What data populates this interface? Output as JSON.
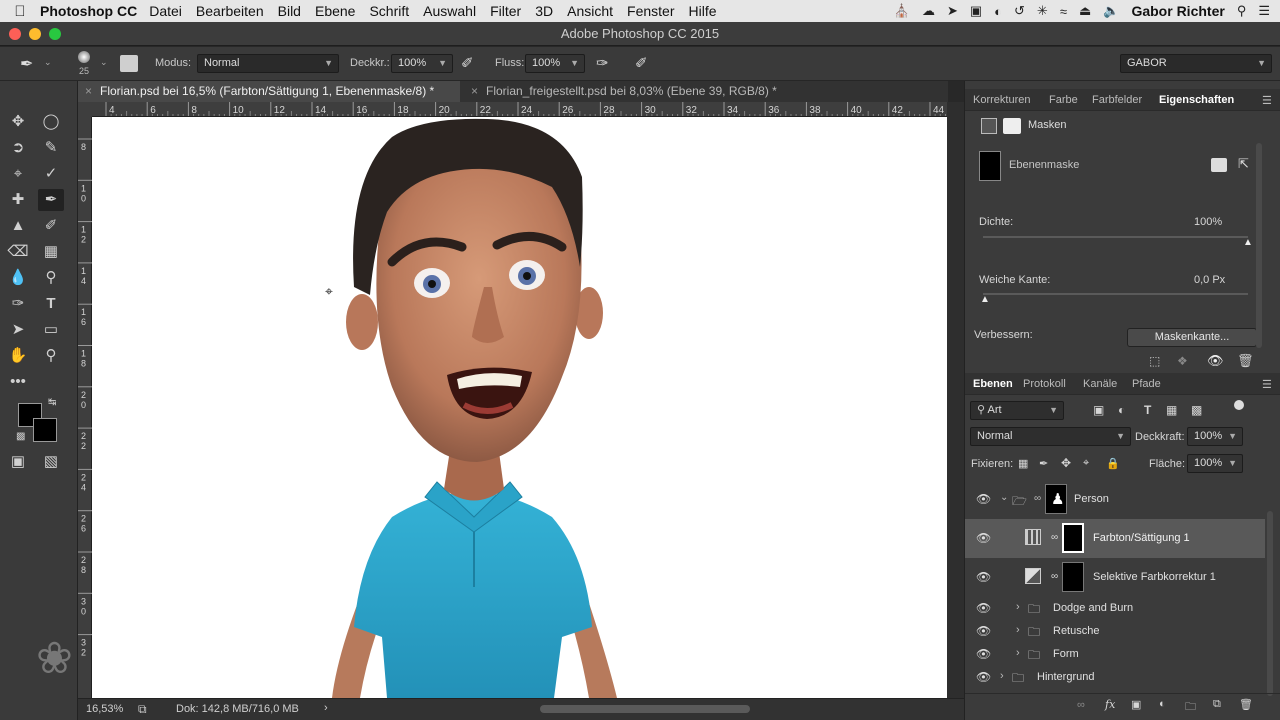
{
  "menubar": {
    "app_name": "Photoshop CC",
    "items": [
      "Datei",
      "Bearbeiten",
      "Bild",
      "Ebene",
      "Schrift",
      "Auswahl",
      "Filter",
      "3D",
      "Ansicht",
      "Fenster",
      "Hilfe"
    ],
    "user": "Gabor Richter"
  },
  "window": {
    "title": "Adobe Photoshop CC 2015"
  },
  "options": {
    "brush_size": "25",
    "mode_label": "Modus:",
    "mode_value": "Normal",
    "opacity_label": "Deckkr.:",
    "opacity_value": "100%",
    "flow_label": "Fluss:",
    "flow_value": "100%",
    "workspace": "GABOR"
  },
  "tabs": [
    {
      "label": "Florian.psd bei 16,5% (Farbton/Sättigung 1, Ebenenmaske/8) *",
      "active": true
    },
    {
      "label": "Florian_freigestellt.psd bei 8,03% (Ebene 39, RGB/8) *",
      "active": false
    }
  ],
  "ruler": {
    "h_ticks": [
      "4",
      "6",
      "8",
      "10",
      "12",
      "14",
      "16",
      "18",
      "20",
      "22",
      "24",
      "26",
      "28",
      "30",
      "32",
      "34",
      "36",
      "38",
      "40",
      "42",
      "44",
      "46"
    ],
    "v_ticks": [
      "8",
      "1\n0",
      "1\n2",
      "1\n4",
      "1\n6",
      "1\n8",
      "2\n0",
      "2\n2",
      "2\n4",
      "2\n6",
      "2\n8",
      "3\n0",
      "3\n2"
    ]
  },
  "status": {
    "zoom": "16,53%",
    "doc": "Dok: 142,8 MB/716,0 MB"
  },
  "properties_panel": {
    "tabs": [
      "Korrekturen",
      "Farbe",
      "Farbfelder",
      "Eigenschaften"
    ],
    "section": "Masken",
    "mask_name": "Ebenenmaske",
    "density_label": "Dichte:",
    "density_value": "100%",
    "density_level": 1.0,
    "feather_label": "Weiche Kante:",
    "feather_value": "0,0 Px",
    "feather_level": 0.0,
    "refine_label": "Verbessern:",
    "refine_button": "Maskenkante..."
  },
  "layers_panel": {
    "tabs": [
      "Ebenen",
      "Protokoll",
      "Kanäle",
      "Pfade"
    ],
    "filter": "Art",
    "blend": "Normal",
    "opacity_label": "Deckkraft:",
    "opacity_value": "100%",
    "lock_label": "Fixieren:",
    "fill_label": "Fläche:",
    "fill_value": "100%",
    "layers": [
      {
        "name": "Person",
        "kind": "group-open"
      },
      {
        "name": "Farbton/Sättigung 1",
        "kind": "adjustment",
        "selected": true
      },
      {
        "name": "Selektive Farbkorrektur 1",
        "kind": "adjustment"
      },
      {
        "name": "Dodge and Burn",
        "kind": "group"
      },
      {
        "name": "Retusche",
        "kind": "group"
      },
      {
        "name": "Form",
        "kind": "group"
      },
      {
        "name": "Hintergrund",
        "kind": "group"
      }
    ]
  },
  "colors": {
    "accent": "#3a87d6",
    "panel": "#3b3b3b",
    "shirt": "#2aa3c8",
    "skin": "#c98a6a"
  }
}
